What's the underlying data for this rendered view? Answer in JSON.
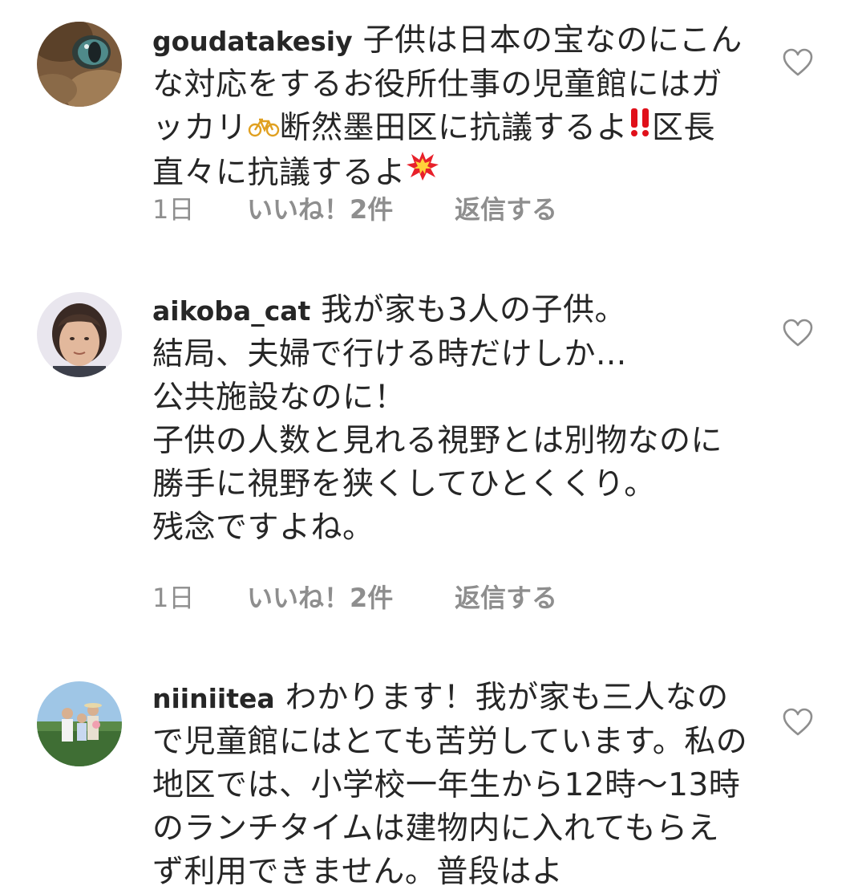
{
  "comments": [
    {
      "username": "goudatakesiy",
      "text_a": "子供は日本の宝なのにこんな対応をするお役所仕事の児童館にはガッカリ",
      "text_b": "断然墨田区に抗議するよ",
      "text_c": "区長直々に抗議するよ",
      "time": "1日",
      "likes": "いいね！2件",
      "reply": "返信する",
      "icons": [
        "bicycle-emoji",
        "double-exclamation-emoji",
        "collision-emoji",
        "heart-icon"
      ]
    },
    {
      "username": "aikoba_cat",
      "text": "我が家も3人の子供。\n結局、夫婦で行ける時だけしか...\n公共施設なのに！\n子供の人数と見れる視野とは別物なのに\n勝手に視野を狭くしてひとくくり。\n残念ですよね。",
      "time": "1日",
      "likes": "いいね！2件",
      "reply": "返信する",
      "icons": [
        "heart-icon"
      ]
    },
    {
      "username": "niiniitea",
      "text": "わかります！我が家も三人なので児童館にはとても苦労しています。私の地区では、小学校一年生から12時〜13時のランチタイムは建物内に入れてもらえず利用できません。普段はよ",
      "icons": [
        "heart-icon"
      ]
    }
  ],
  "colors": {
    "text": "#262626",
    "meta": "#8e8e8e",
    "heart_outline": "#8e8e8e"
  }
}
